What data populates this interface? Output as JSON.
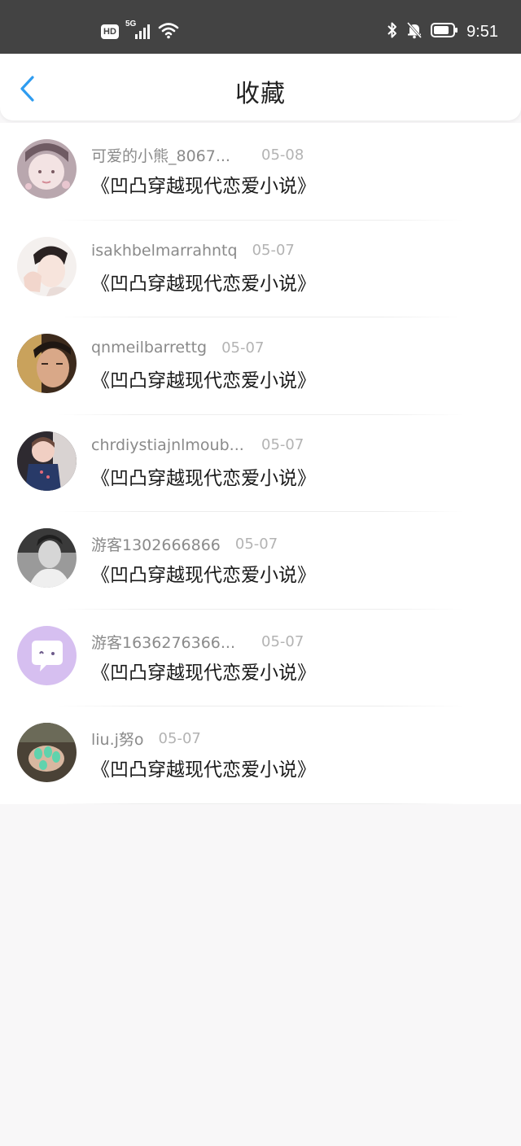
{
  "status_bar": {
    "hd_label": "HD",
    "network_label": "5G",
    "time": "9:51"
  },
  "header": {
    "title": "收藏"
  },
  "favorites": [
    {
      "username": "可爱的小熊_8067...",
      "date": "05-08",
      "book": "《凹凸穿越现代恋爱小说》",
      "avatar": "girl-illustration-avatar"
    },
    {
      "username": "isakhbelmarrahntq",
      "date": "05-07",
      "book": "《凹凸穿越现代恋爱小说》",
      "avatar": "anime-boy-avatar"
    },
    {
      "username": "qnmeilbarrettg",
      "date": "05-07",
      "book": "《凹凸穿越现代恋爱小说》",
      "avatar": "man-photo-avatar"
    },
    {
      "username": "chrdiystiajnlmoub...",
      "date": "05-07",
      "book": "《凹凸穿越现代恋爱小说》",
      "avatar": "child-photo-avatar"
    },
    {
      "username": "游客1302666866",
      "date": "05-07",
      "book": "《凹凸穿越现代恋爱小说》",
      "avatar": "bw-portrait-avatar"
    },
    {
      "username": "游客1636276366...",
      "date": "05-07",
      "book": "《凹凸穿越现代恋爱小说》",
      "avatar": "chat-bubble-avatar"
    },
    {
      "username": "liu.j努o",
      "date": "05-07",
      "book": "《凹凸穿越现代恋爱小说》",
      "avatar": "green-nails-avatar"
    }
  ],
  "colors": {
    "status_bar_bg": "#434343",
    "accent_back_arrow": "#2e9cf0",
    "page_bg": "#f8f7f8"
  }
}
